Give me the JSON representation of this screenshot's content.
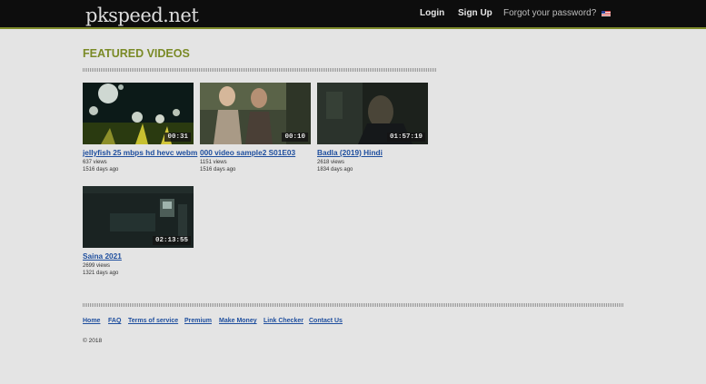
{
  "header": {
    "logo": "pkspeed.net",
    "login": "Login",
    "signup": "Sign Up",
    "forgot": "Forgot your password?",
    "language_icon": "us-flag-icon"
  },
  "main": {
    "section_title": "FEATURED VIDEOS",
    "videos": [
      {
        "title": "jellyfish 25 mbps hd hevc webm",
        "views": "637 views",
        "age": "1516 days ago",
        "duration": "00:31"
      },
      {
        "title": "000 video sample2 S01E03",
        "views": "1151 views",
        "age": "1516 days ago",
        "duration": "00:10"
      },
      {
        "title": "Badla (2019) Hindi",
        "views": "2618 views",
        "age": "1834 days ago",
        "duration": "01:57:19"
      },
      {
        "title": "Saina 2021",
        "views": "2699 views",
        "age": "1321 days ago",
        "duration": "02:13:55"
      }
    ]
  },
  "footer": {
    "links": [
      "Home",
      "FAQ",
      "Terms of service",
      "Premium",
      "Make Money",
      "Link Checker",
      "Contact Us"
    ],
    "copyright": "© 2018"
  },
  "colors": {
    "header_bg": "#0d0d0d",
    "accent": "#7a8a26",
    "link": "#1e4e9e",
    "page_bg": "#e4e4e4"
  }
}
